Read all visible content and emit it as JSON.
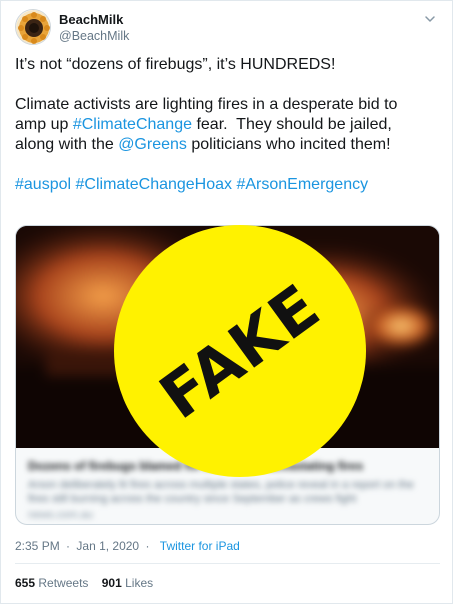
{
  "user": {
    "display_name": "BeachMilk",
    "handle": "@BeachMilk"
  },
  "tweet": {
    "line1": "It’s not “dozens of firebugs”, it’s HUNDREDS!",
    "para2_a": "Climate activists are lighting fires in a desperate bid to",
    "para2_b": "amp up ",
    "hashtag_climatechange": "#ClimateChange",
    "para2_c": " fear.  They should be jailed,",
    "para2_d": "along with the ",
    "mention_greens": "@Greens",
    "para2_e": " politicians who incited them!",
    "hashtag_auspol": "#auspol",
    "hashtag_hoax": "#ClimateChangeHoax",
    "hashtag_arson": "#ArsonEmergency"
  },
  "card": {
    "title": "Dozens of firebugs blamed for Australia's devastating fires",
    "desc": "Arson deliberately lit fires across multiple states, police reveal in a report on the fires still burning across the country since September as crews fight",
    "url": "news.com.au"
  },
  "overlay": {
    "label": "FAKE",
    "color": "#fff200"
  },
  "meta": {
    "time": "2:35 PM",
    "separator": "·",
    "date": "Jan 1, 2020",
    "source_sep": "·",
    "source": "Twitter for iPad"
  },
  "stats": {
    "retweets_count": "655",
    "retweets_label": "Retweets",
    "likes_count": "901",
    "likes_label": "Likes"
  },
  "colors": {
    "link": "#1b95e0",
    "muted": "#657786",
    "text": "#14171a"
  },
  "icons": {
    "caret": "chevron-down-icon",
    "avatar": "sunflower-logo"
  }
}
